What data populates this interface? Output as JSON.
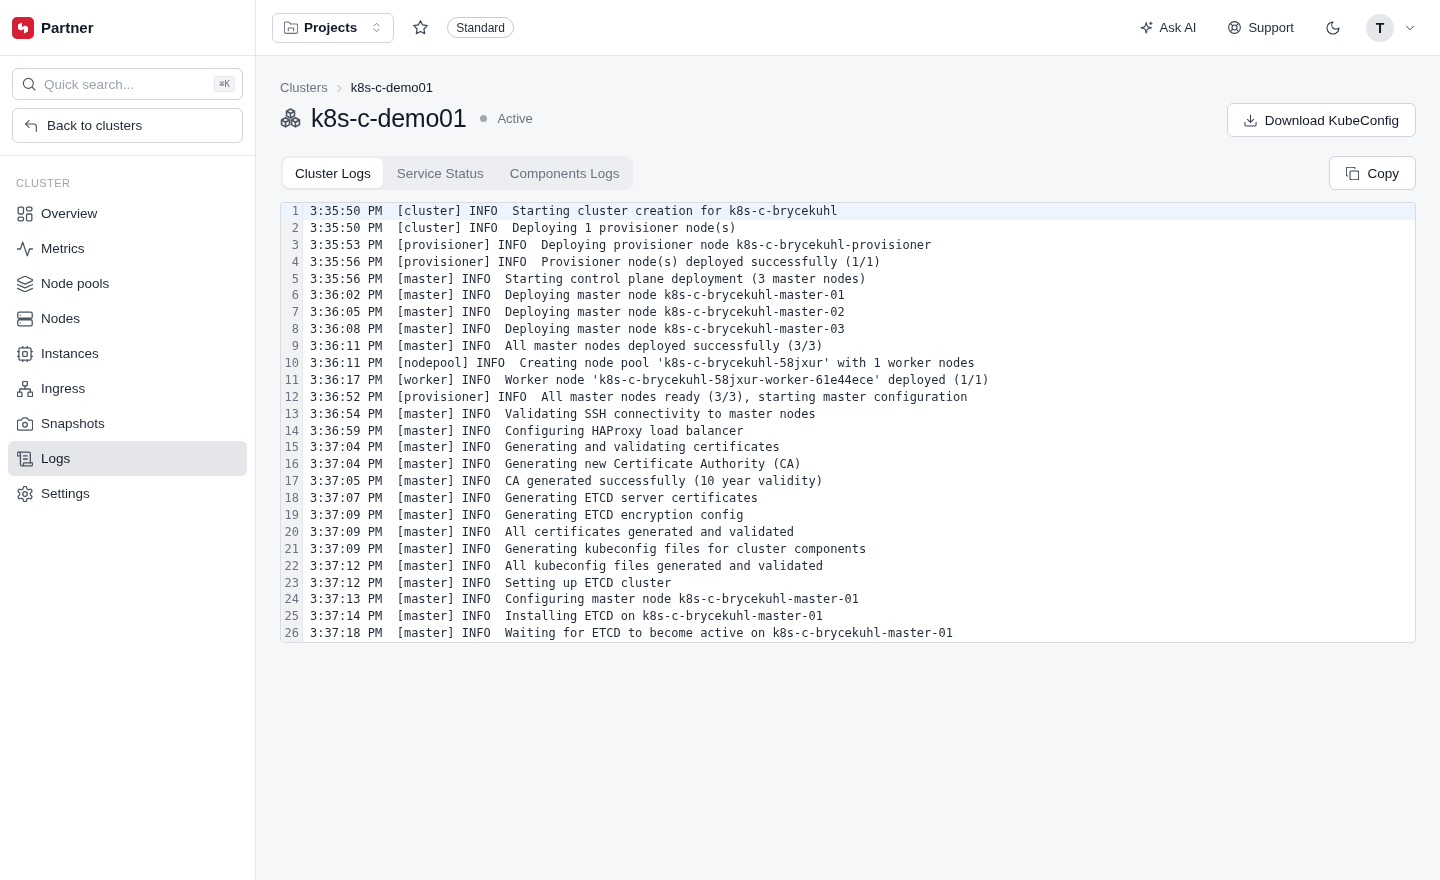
{
  "sidebar": {
    "brand": "Partner",
    "search": {
      "placeholder": "Quick search...",
      "shortcut": "⌘K"
    },
    "back_button": "Back to clusters",
    "section_label": "CLUSTER",
    "items": [
      {
        "label": "Overview",
        "selected": false
      },
      {
        "label": "Metrics",
        "selected": false
      },
      {
        "label": "Node pools",
        "selected": false
      },
      {
        "label": "Nodes",
        "selected": false
      },
      {
        "label": "Instances",
        "selected": false
      },
      {
        "label": "Ingress",
        "selected": false
      },
      {
        "label": "Snapshots",
        "selected": false
      },
      {
        "label": "Logs",
        "selected": true
      },
      {
        "label": "Settings",
        "selected": false
      }
    ]
  },
  "topbar": {
    "project_selector": "Projects",
    "plan_badge": "Standard",
    "actions": [
      {
        "label": "Ask AI"
      },
      {
        "label": "Support"
      }
    ],
    "avatar": "T"
  },
  "breadcrumb": [
    {
      "label": "Clusters"
    },
    {
      "label": "k8s-c-demo01"
    }
  ],
  "title": "k8s-c-demo01",
  "status": "Active",
  "download_button": "Download KubeConfig",
  "tabs": [
    {
      "label": "Cluster Logs",
      "selected": true
    },
    {
      "label": "Service Status",
      "selected": false
    },
    {
      "label": "Components Logs",
      "selected": false
    }
  ],
  "copy_button": "Copy",
  "log": {
    "lines": [
      {
        "number": "1",
        "text": "3:35:50 PM  [cluster] INFO  Starting cluster creation for k8s-c-brycekuhl",
        "active": true
      },
      {
        "number": "2",
        "text": "3:35:50 PM  [cluster] INFO  Deploying 1 provisioner node(s)",
        "active": false
      },
      {
        "number": "3",
        "text": "3:35:53 PM  [provisioner] INFO  Deploying provisioner node k8s-c-brycekuhl-provisioner",
        "active": false
      },
      {
        "number": "4",
        "text": "3:35:56 PM  [provisioner] INFO  Provisioner node(s) deployed successfully (1/1)",
        "active": false
      },
      {
        "number": "5",
        "text": "3:35:56 PM  [master] INFO  Starting control plane deployment (3 master nodes)",
        "active": false
      },
      {
        "number": "6",
        "text": "3:36:02 PM  [master] INFO  Deploying master node k8s-c-brycekuhl-master-01",
        "active": false
      },
      {
        "number": "7",
        "text": "3:36:05 PM  [master] INFO  Deploying master node k8s-c-brycekuhl-master-02",
        "active": false
      },
      {
        "number": "8",
        "text": "3:36:08 PM  [master] INFO  Deploying master node k8s-c-brycekuhl-master-03",
        "active": false
      },
      {
        "number": "9",
        "text": "3:36:11 PM  [master] INFO  All master nodes deployed successfully (3/3)",
        "active": false
      },
      {
        "number": "10",
        "text": "3:36:11 PM  [nodepool] INFO  Creating node pool 'k8s-c-brycekuhl-58jxur' with 1 worker nodes",
        "active": false
      },
      {
        "number": "11",
        "text": "3:36:17 PM  [worker] INFO  Worker node 'k8s-c-brycekuhl-58jxur-worker-61e44ece' deployed (1/1)",
        "active": false
      },
      {
        "number": "12",
        "text": "3:36:52 PM  [provisioner] INFO  All master nodes ready (3/3), starting master configuration",
        "active": false
      },
      {
        "number": "13",
        "text": "3:36:54 PM  [master] INFO  Validating SSH connectivity to master nodes",
        "active": false
      },
      {
        "number": "14",
        "text": "3:36:59 PM  [master] INFO  Configuring HAProxy load balancer",
        "active": false
      },
      {
        "number": "15",
        "text": "3:37:04 PM  [master] INFO  Generating and validating certificates",
        "active": false
      },
      {
        "number": "16",
        "text": "3:37:04 PM  [master] INFO  Generating new Certificate Authority (CA)",
        "active": false
      },
      {
        "number": "17",
        "text": "3:37:05 PM  [master] INFO  CA generated successfully (10 year validity)",
        "active": false
      },
      {
        "number": "18",
        "text": "3:37:07 PM  [master] INFO  Generating ETCD server certificates",
        "active": false
      },
      {
        "number": "19",
        "text": "3:37:09 PM  [master] INFO  Generating ETCD encryption config",
        "active": false
      },
      {
        "number": "20",
        "text": "3:37:09 PM  [master] INFO  All certificates generated and validated",
        "active": false
      },
      {
        "number": "21",
        "text": "3:37:09 PM  [master] INFO  Generating kubeconfig files for cluster components",
        "active": false
      },
      {
        "number": "22",
        "text": "3:37:12 PM  [master] INFO  All kubeconfig files generated and validated",
        "active": false
      },
      {
        "number": "23",
        "text": "3:37:12 PM  [master] INFO  Setting up ETCD cluster",
        "active": false
      },
      {
        "number": "24",
        "text": "3:37:13 PM  [master] INFO  Configuring master node k8s-c-brycekuhl-master-01",
        "active": false
      },
      {
        "number": "25",
        "text": "3:37:14 PM  [master] INFO  Installing ETCD on k8s-c-brycekuhl-master-01",
        "active": false
      },
      {
        "number": "26",
        "text": "3:37:18 PM  [master] INFO  Waiting for ETCD to become active on k8s-c-brycekuhl-master-01",
        "active": false
      }
    ]
  }
}
